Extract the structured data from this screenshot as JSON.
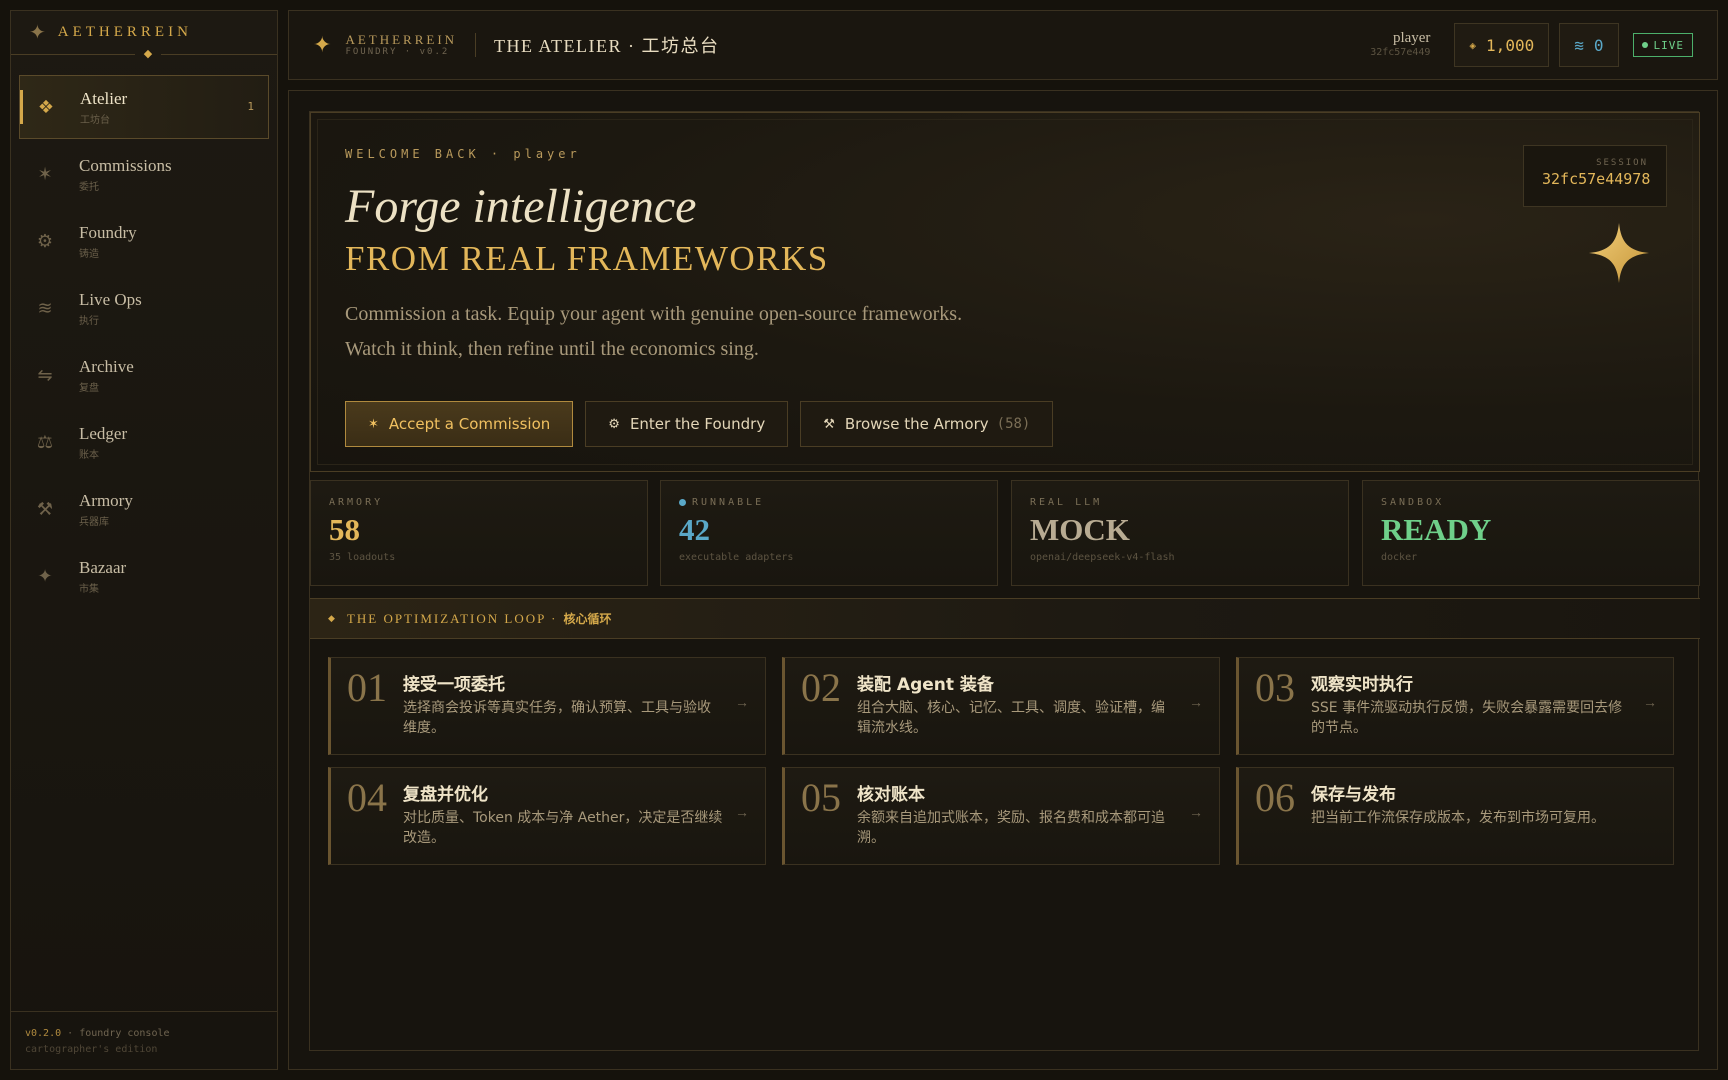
{
  "sidebar": {
    "brand": "AETHERREIN",
    "items": [
      {
        "en": "Atelier",
        "zh": "工坊台",
        "icon": "❖",
        "badge": "1"
      },
      {
        "en": "Commissions",
        "zh": "委托",
        "icon": "✶"
      },
      {
        "en": "Foundry",
        "zh": "铸造",
        "icon": "⚙"
      },
      {
        "en": "Live Ops",
        "zh": "执行",
        "icon": "≋"
      },
      {
        "en": "Archive",
        "zh": "复盘",
        "icon": "⇋"
      },
      {
        "en": "Ledger",
        "zh": "账本",
        "icon": "⚖"
      },
      {
        "en": "Armory",
        "zh": "兵器库",
        "icon": "⚒"
      },
      {
        "en": "Bazaar",
        "zh": "市集",
        "icon": "✦"
      }
    ],
    "footer_version": "v0.2.0",
    "footer_label": "· foundry console",
    "footer_edition": "cartographer's edition"
  },
  "topbar": {
    "brand": "AETHERREIN",
    "brand_sub": "FOUNDRY · v0.2",
    "title": "THE ATELIER · 工坊总台",
    "user": "player",
    "user_id": "32fc57e449",
    "gold_glyph": "◈",
    "gold": "1,000",
    "aether_glyph": "≋",
    "aether": "0",
    "live": "LIVE"
  },
  "hero": {
    "welcome": "WELCOME BACK · player",
    "line1": "Forge intelligence",
    "line2": "FROM REAL FRAMEWORKS",
    "desc1": "Commission a task. Equip your agent with genuine open-source frameworks.",
    "desc2": "Watch it think, then refine until the economics sing.",
    "session_label": "SESSION",
    "session_id": "32fc57e44978",
    "buttons": {
      "accept": {
        "icon": "✶",
        "label": "Accept a Commission"
      },
      "foundry": {
        "icon": "⚙",
        "label": "Enter the Foundry"
      },
      "armory": {
        "icon": "⚒",
        "label": "Browse the Armory",
        "count": "(58)"
      }
    }
  },
  "stats": [
    {
      "label": "ARMORY",
      "value": "58",
      "sub": "35 loadouts",
      "color": "#e3b75a"
    },
    {
      "label": "RUNNABLE",
      "value": "42",
      "sub": "executable adapters",
      "color": "#5aa8c8"
    },
    {
      "label": "REAL LLM",
      "value": "MOCK",
      "sub": "openai/deepseek-v4-flash",
      "color": "#b8ab92"
    },
    {
      "label": "SANDBOX",
      "value": "READY",
      "sub": "docker",
      "color": "#6fd08a"
    }
  ],
  "loop": {
    "title": "THE OPTIMIZATION LOOP ·",
    "title_zh": "核心循环",
    "steps": [
      {
        "num": "01",
        "title": "接受一项委托",
        "text": "选择商会投诉等真实任务，确认预算、工具与验收维度。",
        "arrow": "→"
      },
      {
        "num": "02",
        "title": "装配 Agent 装备",
        "text": "组合大脑、核心、记忆、工具、调度、验证槽，编辑流水线。",
        "arrow": "→"
      },
      {
        "num": "03",
        "title": "观察实时执行",
        "text": "SSE 事件流驱动执行反馈，失败会暴露需要回去修的节点。",
        "arrow": "→"
      },
      {
        "num": "04",
        "title": "复盘并优化",
        "text": "对比质量、Token 成本与净 Aether，决定是否继续改造。",
        "arrow": "→"
      },
      {
        "num": "05",
        "title": "核对账本",
        "text": "余额来自追加式账本，奖励、报名费和成本都可追溯。",
        "arrow": "→"
      },
      {
        "num": "06",
        "title": "保存与发布",
        "text": "把当前工作流保存成版本，发布到市场可复用。",
        "arrow": ""
      }
    ]
  }
}
